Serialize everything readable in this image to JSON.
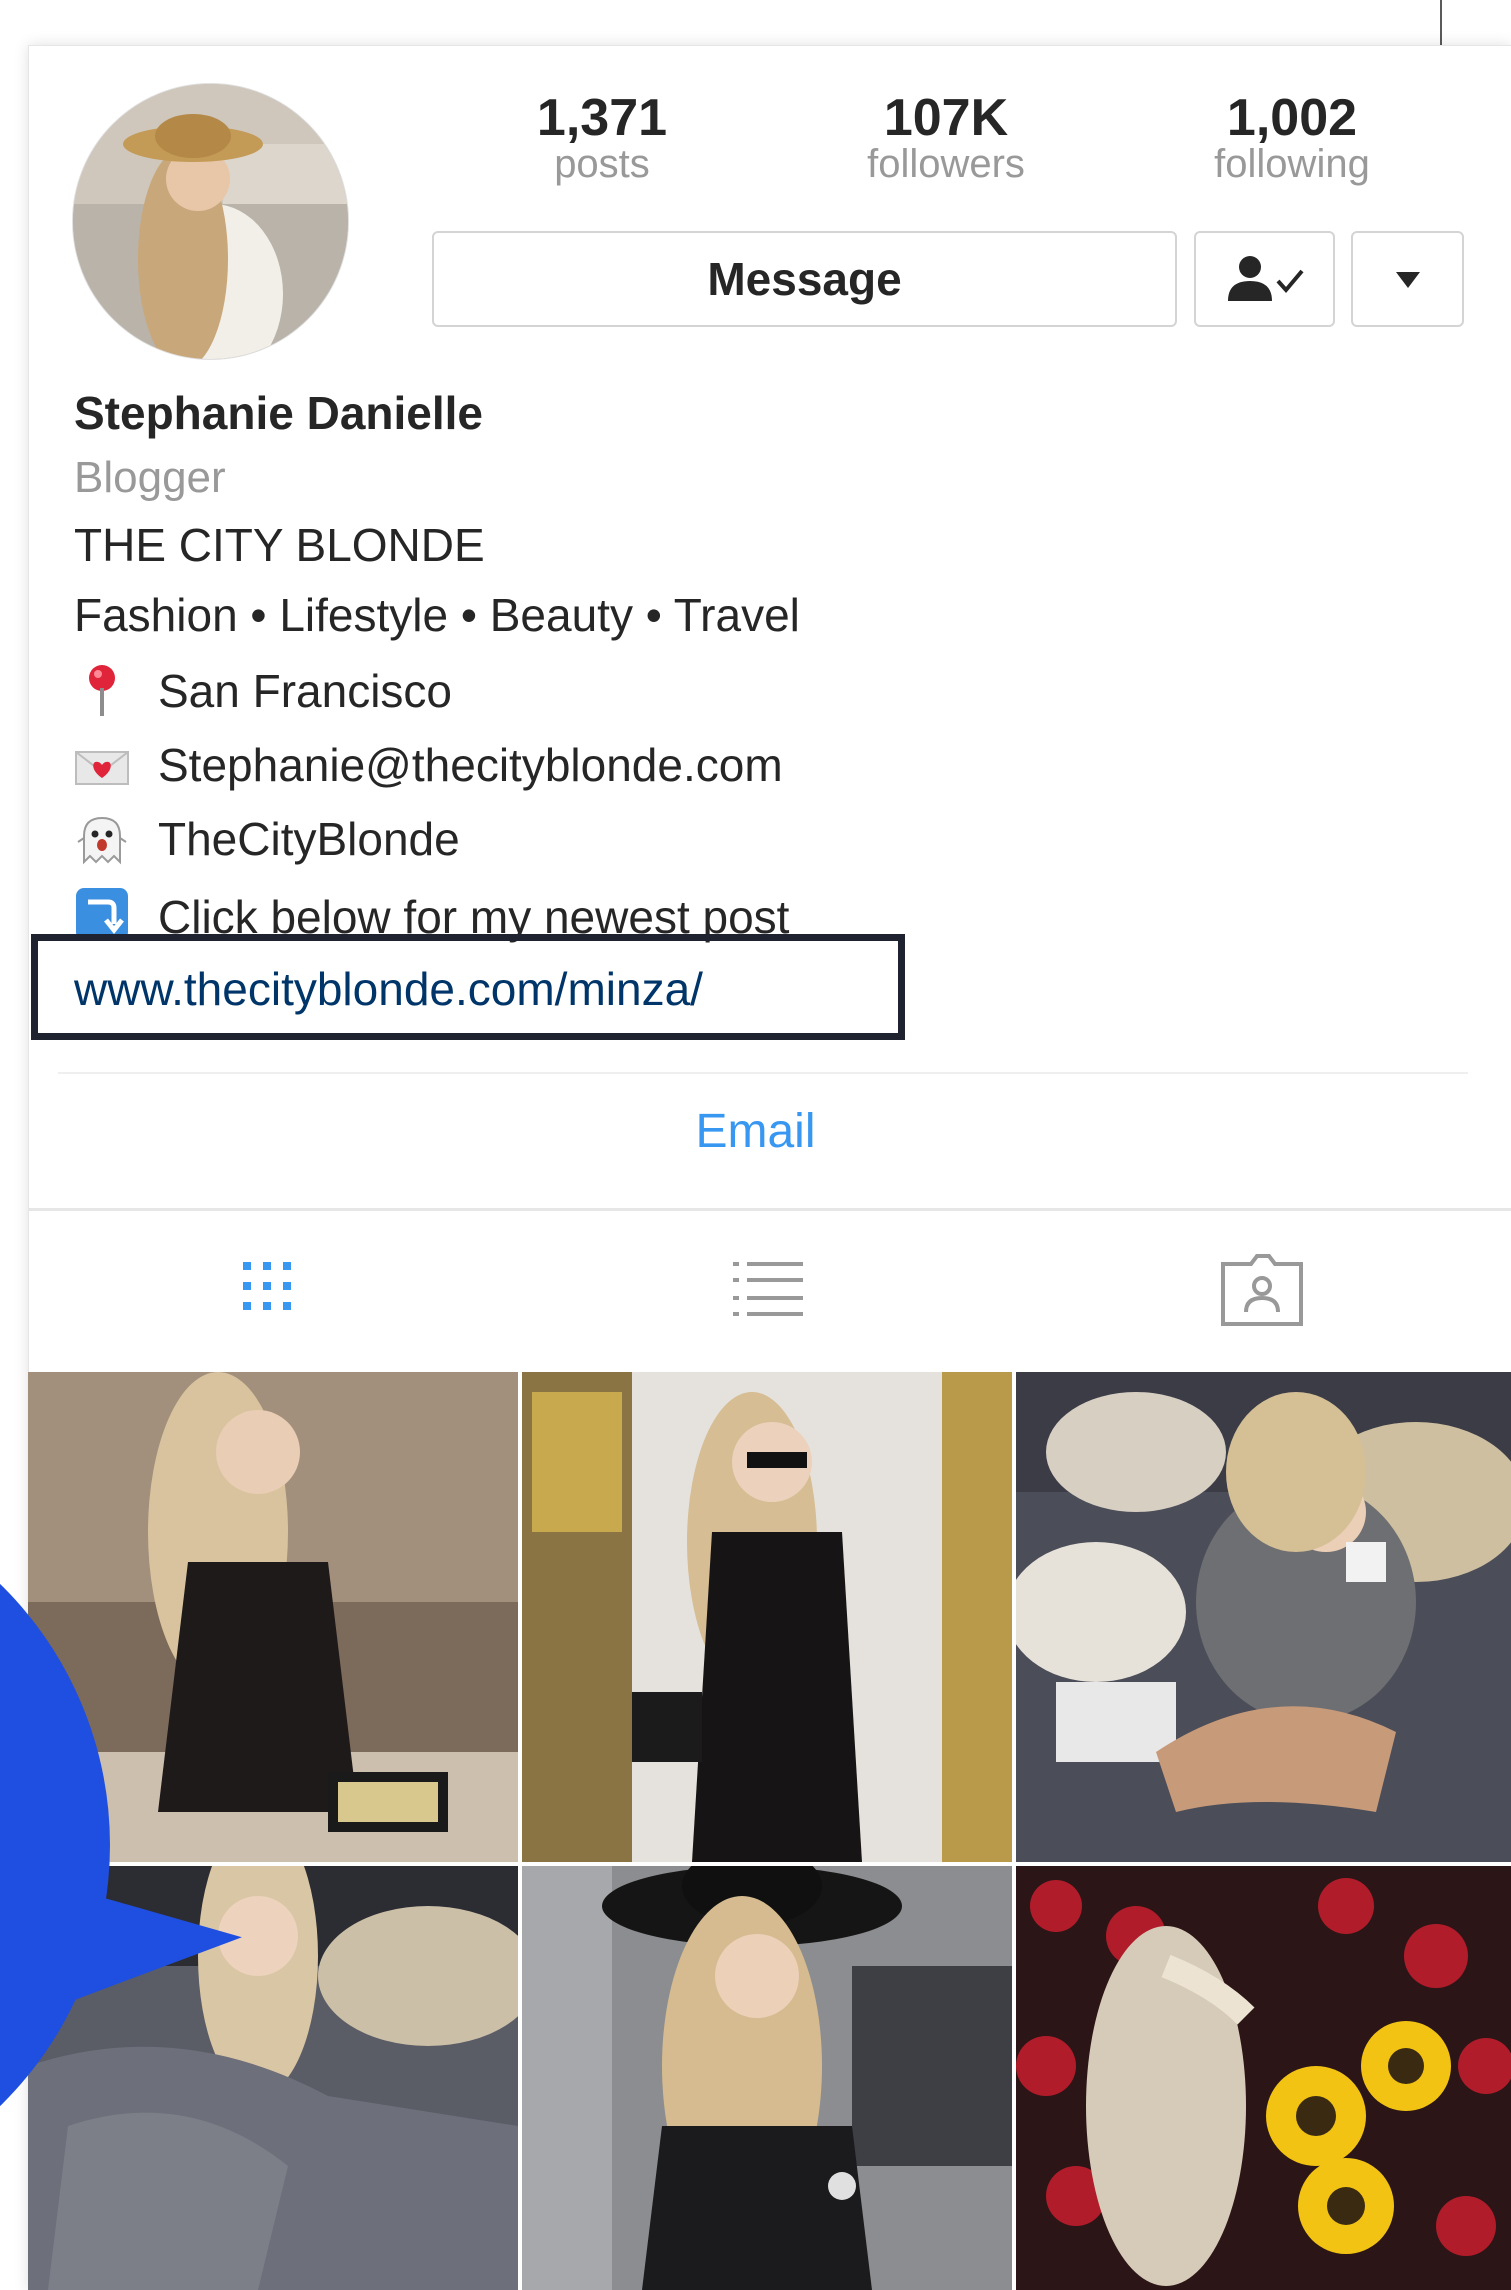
{
  "stats": {
    "posts_count": "1,371",
    "posts_label": "posts",
    "followers_count": "107K",
    "followers_label": "followers",
    "following_count": "1,002",
    "following_label": "following"
  },
  "actions": {
    "message_label": "Message"
  },
  "bio": {
    "name": "Stephanie Danielle",
    "category": "Blogger",
    "line1": "THE CITY BLONDE",
    "line2": "Fashion • Lifestyle • Beauty • Travel",
    "location": "San Francisco",
    "email": "Stephanie@thecityblonde.com",
    "snapchat": "TheCityBlonde",
    "cta": "Click below for my newest post",
    "website": "www.thecityblonde.com/minza/"
  },
  "contact": {
    "email_button": "Email"
  },
  "icons": {
    "location": "pin-icon",
    "email": "love-letter-icon",
    "snapchat": "ghost-icon",
    "cta": "arrow-down-icon",
    "following": "person-check-icon",
    "more": "caret-down-icon",
    "grid_tab": "grid-icon",
    "list_tab": "list-icon",
    "tagged_tab": "tagged-user-icon"
  },
  "colors": {
    "accent_blue": "#3897f0",
    "link_blue": "#003569",
    "muted_gray": "#999999",
    "highlight_box": "#1f2330",
    "bubble_blue": "#1f4fe0"
  },
  "grid_photos": [
    {
      "name": "photo-lace-dress-clutch"
    },
    {
      "name": "photo-black-dress-sunglasses"
    },
    {
      "name": "photo-sweater-coffee-bed"
    },
    {
      "name": "photo-gray-bedding"
    },
    {
      "name": "photo-black-hat-leather-jacket"
    },
    {
      "name": "photo-braid-sunflowers"
    }
  ]
}
